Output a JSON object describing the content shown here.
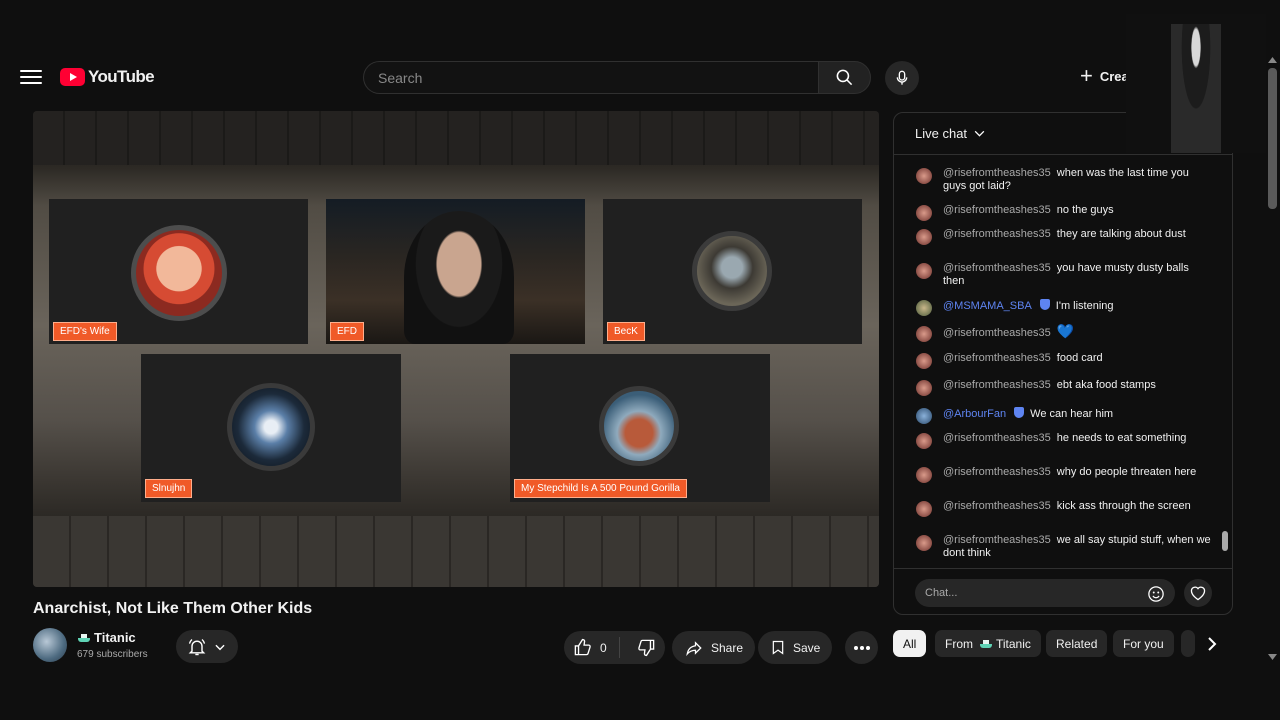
{
  "header": {
    "logo_text": "YouTube",
    "search_placeholder": "Search",
    "create_label": "Create"
  },
  "player": {
    "participants": [
      {
        "name": "EFD's Wife"
      },
      {
        "name": "EFD"
      },
      {
        "name": "BecK"
      },
      {
        "name": "Slnujhn"
      },
      {
        "name": "My Stepchild Is A 500 Pound Gorilla"
      }
    ]
  },
  "video": {
    "title": "Anarchist, Not Like Them Other Kids",
    "channel_name": "Titanic",
    "subscribers": "679 subscribers",
    "like_count": "0",
    "share_label": "Share",
    "save_label": "Save"
  },
  "chat": {
    "header": "Live chat",
    "input_placeholder": "Chat...",
    "messages": [
      {
        "author": "@risefromtheashes35",
        "text": "when was the last time you guys got laid?",
        "mod": false
      },
      {
        "author": "@risefromtheashes35",
        "text": "no the guys",
        "mod": false
      },
      {
        "author": "@risefromtheashes35",
        "text": "they are talking about dust",
        "mod": false
      },
      {
        "author": "@risefromtheashes35",
        "text": "you have musty dusty balls then",
        "mod": false
      },
      {
        "author": "@MSMAMA_SBA",
        "text": "I'm listening",
        "mod": true
      },
      {
        "author": "@risefromtheashes35",
        "text": "💙",
        "mod": false
      },
      {
        "author": "@risefromtheashes35",
        "text": "food card",
        "mod": false
      },
      {
        "author": "@risefromtheashes35",
        "text": "ebt aka food stamps",
        "mod": false
      },
      {
        "author": "@ArbourFan",
        "text": "We can hear him",
        "mod": true
      },
      {
        "author": "@risefromtheashes35",
        "text": "he needs to eat something",
        "mod": false
      },
      {
        "author": "@risefromtheashes35",
        "text": "why do people threaten here",
        "mod": false
      },
      {
        "author": "@risefromtheashes35",
        "text": "kick ass through the screen",
        "mod": false
      },
      {
        "author": "@risefromtheashes35",
        "text": "we all say stupid stuff, when we dont think",
        "mod": false
      }
    ]
  },
  "chips": {
    "all": "All",
    "from_prefix": "From",
    "from_channel": "Titanic",
    "related": "Related",
    "for_you": "For you"
  },
  "colors": {
    "accent_red": "#ff0033",
    "mod_blue": "#5e84f1",
    "tag_orange": "#f05a28"
  }
}
